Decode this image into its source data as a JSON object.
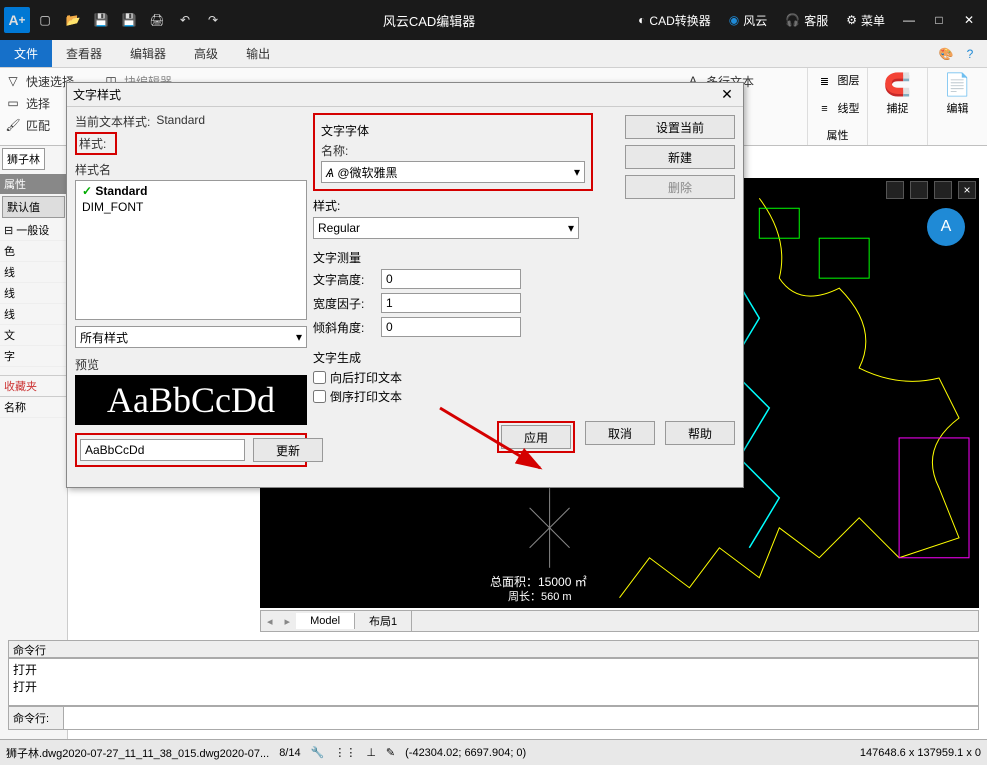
{
  "titlebar": {
    "app_title": "风云CAD编辑器",
    "btn_cad_converter": "CAD转换器",
    "btn_fengyun": "风云",
    "btn_support": "客服",
    "btn_menu": "菜单"
  },
  "menubar": {
    "items": [
      "文件",
      "查看器",
      "编辑器",
      "高级",
      "输出"
    ],
    "active_index": 0
  },
  "ribbon": {
    "left_row1": {
      "quick_select": "快速选择",
      "block_editor": "块编辑器"
    },
    "left_row2": {
      "select": "选择",
      "multiline_text": "多行文本"
    },
    "left_row3": {
      "match": "匹配"
    },
    "groups": {
      "layer": "图层",
      "linetype": "线型",
      "props": "属性",
      "snap": "捕捉",
      "edit": "编辑"
    }
  },
  "leftpanel": {
    "doc_tab": "狮子林",
    "props_header": "属性",
    "defaults": "默认值",
    "general": "一般设",
    "rows": [
      "色",
      "线",
      "线",
      "线",
      "文",
      "字"
    ],
    "favorites": "收藏夹",
    "name_label": "名称"
  },
  "dialog": {
    "title": "文字样式",
    "current_style_label": "当前文本样式:",
    "current_style_value": "Standard",
    "style_section": "样式:",
    "style_name_header": "样式名",
    "style_list": [
      {
        "name": "Standard",
        "selected": true
      },
      {
        "name": "DIM_FONT",
        "selected": false
      }
    ],
    "all_styles": "所有样式",
    "preview_label": "预览",
    "preview_text": "AaBbCcDd",
    "preview_input": "AaBbCcDd",
    "update_btn": "更新",
    "font_section": "文字字体",
    "name_label": "名称:",
    "font_name": "@微软雅黑",
    "style_label": "样式:",
    "font_style": "Regular",
    "measure_section": "文字测量",
    "height_label": "文字高度:",
    "height_value": "0",
    "width_label": "宽度因子:",
    "width_value": "1",
    "oblique_label": "倾斜角度:",
    "oblique_value": "0",
    "gen_section": "文字生成",
    "backward": "向后打印文本",
    "upside": "倒序打印文本",
    "btn_setcurrent": "设置当前",
    "btn_new": "新建",
    "btn_delete": "删除",
    "btn_apply": "应用",
    "btn_cancel": "取消",
    "btn_help": "帮助"
  },
  "drawing": {
    "total_area": "总面积：15000 ㎡",
    "perimeter": "周长：560 m"
  },
  "layout_tabs": {
    "model": "Model",
    "layout1": "布局1"
  },
  "cmd": {
    "label": "命令行",
    "history": [
      "打开",
      "打开"
    ],
    "prompt": "命令行:"
  },
  "statusbar": {
    "file": "狮子林.dwg2020-07-27_11_11_38_015.dwg2020-07...",
    "pages": "8/14",
    "coords": "(-42304.02; 6697.904; 0)",
    "dims": "147648.6 x 137959.1 x 0"
  }
}
